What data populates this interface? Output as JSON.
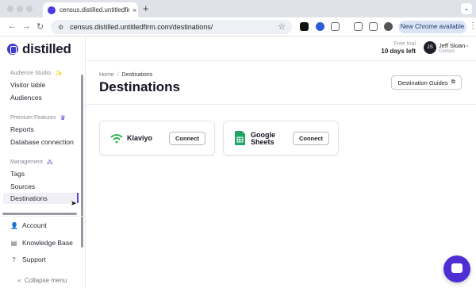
{
  "browser": {
    "tab_title": "census.distilled.untitledfirm.c",
    "tab_close": "×",
    "new_tab": "+",
    "url": "census.distilled.untitledfirm.com/destinations/",
    "chrome_button": "New Chrome available",
    "icons": [
      "back-icon",
      "forward-icon",
      "reload-icon",
      "lock-icon",
      "star-icon",
      "extensions-icon",
      "menu-icon"
    ]
  },
  "app": {
    "logo_text": "distilled",
    "trial_label": "Free trial",
    "trial_days": "10 days left",
    "user_initials": "JS",
    "user_name": "Jeff Sloan",
    "user_org": "Census",
    "accent_color": "#4f2fd4"
  },
  "sidebar": {
    "sections": [
      {
        "label": "Audience Studio",
        "items": [
          "Visitor table",
          "Audiences"
        ]
      },
      {
        "label": "Premium Features",
        "items": [
          "Reports",
          "Database connection"
        ]
      },
      {
        "label": "Management",
        "items": [
          "Tags",
          "Sources",
          "Destinations"
        ]
      }
    ],
    "active_item": "Destinations",
    "footer": [
      "Account",
      "Knowledge Base",
      "Support"
    ],
    "collapse_label": "Collapse menu"
  },
  "main": {
    "breadcrumb": [
      "Home",
      "Destinations"
    ],
    "breadcrumb_sep": "/",
    "title": "Destinations",
    "guides_button": "Destination Guides",
    "destinations": [
      {
        "name": "Klaviyo",
        "button": "Connect"
      },
      {
        "name_line1": "Google",
        "name_line2": "Sheets",
        "button": "Connect"
      }
    ]
  }
}
